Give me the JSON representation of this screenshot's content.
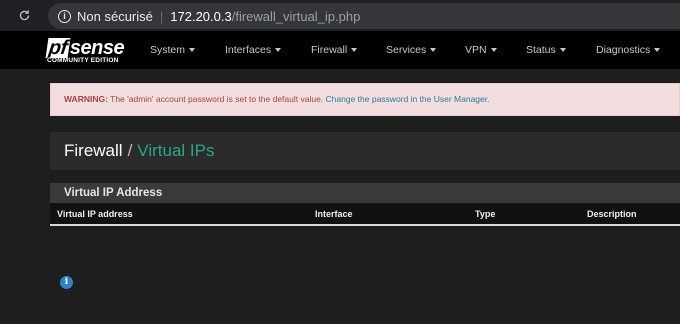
{
  "browser": {
    "security_label": "Non sécurisé",
    "host": "172.20.0.3",
    "path": "/firewall_virtual_ip.php"
  },
  "logo": {
    "pf": "pf",
    "sense": "sense",
    "edition": "COMMUNITY EDITION"
  },
  "nav": {
    "items": [
      "System",
      "Interfaces",
      "Firewall",
      "Services",
      "VPN",
      "Status",
      "Diagnostics"
    ]
  },
  "alert": {
    "prefix": "WARNING:",
    "message": " The 'admin' account password is set to the default value. ",
    "link": "Change the password in the User Manager."
  },
  "breadcrumb": {
    "parent": "Firewall",
    "separator": "/",
    "current": "Virtual IPs"
  },
  "panel": {
    "title": "Virtual IP Address",
    "columns": [
      "Virtual IP address",
      "Interface",
      "Type",
      "Description"
    ]
  },
  "icons": {
    "info": "i"
  },
  "colors": {
    "accent": "#24a98a",
    "alert_bg": "#f2dede",
    "alert_text": "#a94442",
    "info_blue": "#2f84c9"
  }
}
